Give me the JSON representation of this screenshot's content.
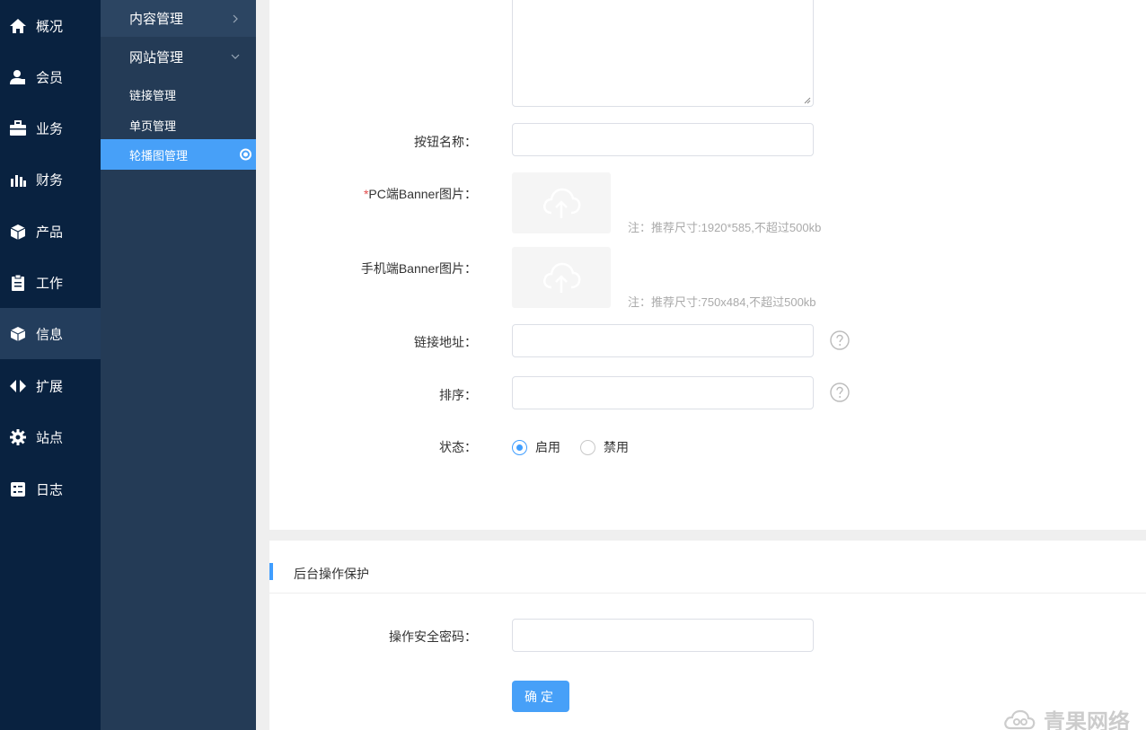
{
  "primary_nav": [
    {
      "label": "概况",
      "icon": "home-icon"
    },
    {
      "label": "会员",
      "icon": "user-icon"
    },
    {
      "label": "业务",
      "icon": "briefcase-icon"
    },
    {
      "label": "财务",
      "icon": "bar-chart-icon"
    },
    {
      "label": "产品",
      "icon": "box-icon"
    },
    {
      "label": "工作",
      "icon": "clipboard-icon"
    },
    {
      "label": "信息",
      "icon": "cube-icon",
      "active": true
    },
    {
      "label": "扩展",
      "icon": "arrows-icon"
    },
    {
      "label": "站点",
      "icon": "gear-icon"
    },
    {
      "label": "日志",
      "icon": "log-icon"
    }
  ],
  "secondary_nav": {
    "group1": "内容管理",
    "group2": "网站管理",
    "items": [
      "链接管理",
      "单页管理",
      "轮播图管理"
    ],
    "active_item": "轮播图管理"
  },
  "form": {
    "button_name_label": "按钮名称：",
    "pc_banner_required_mark": "*",
    "pc_banner_label": "PC端Banner图片：",
    "pc_banner_hint": "注：推荐尺寸:1920*585,不超过500kb",
    "mobile_banner_label": "手机端Banner图片：",
    "mobile_banner_hint": "注：推荐尺寸:750x484,不超过500kb",
    "link_label": "链接地址：",
    "sort_label": "排序：",
    "status_label": "状态：",
    "status_options": [
      "启用",
      "禁用"
    ],
    "status_selected": "启用"
  },
  "protection": {
    "title": "后台操作保护",
    "password_label": "操作安全密码：",
    "submit_label": "确定"
  },
  "watermark": "青果网络",
  "colors": {
    "primary_nav_bg": "#092240",
    "secondary_nav_bg": "#243b56",
    "accent": "#409eff"
  }
}
